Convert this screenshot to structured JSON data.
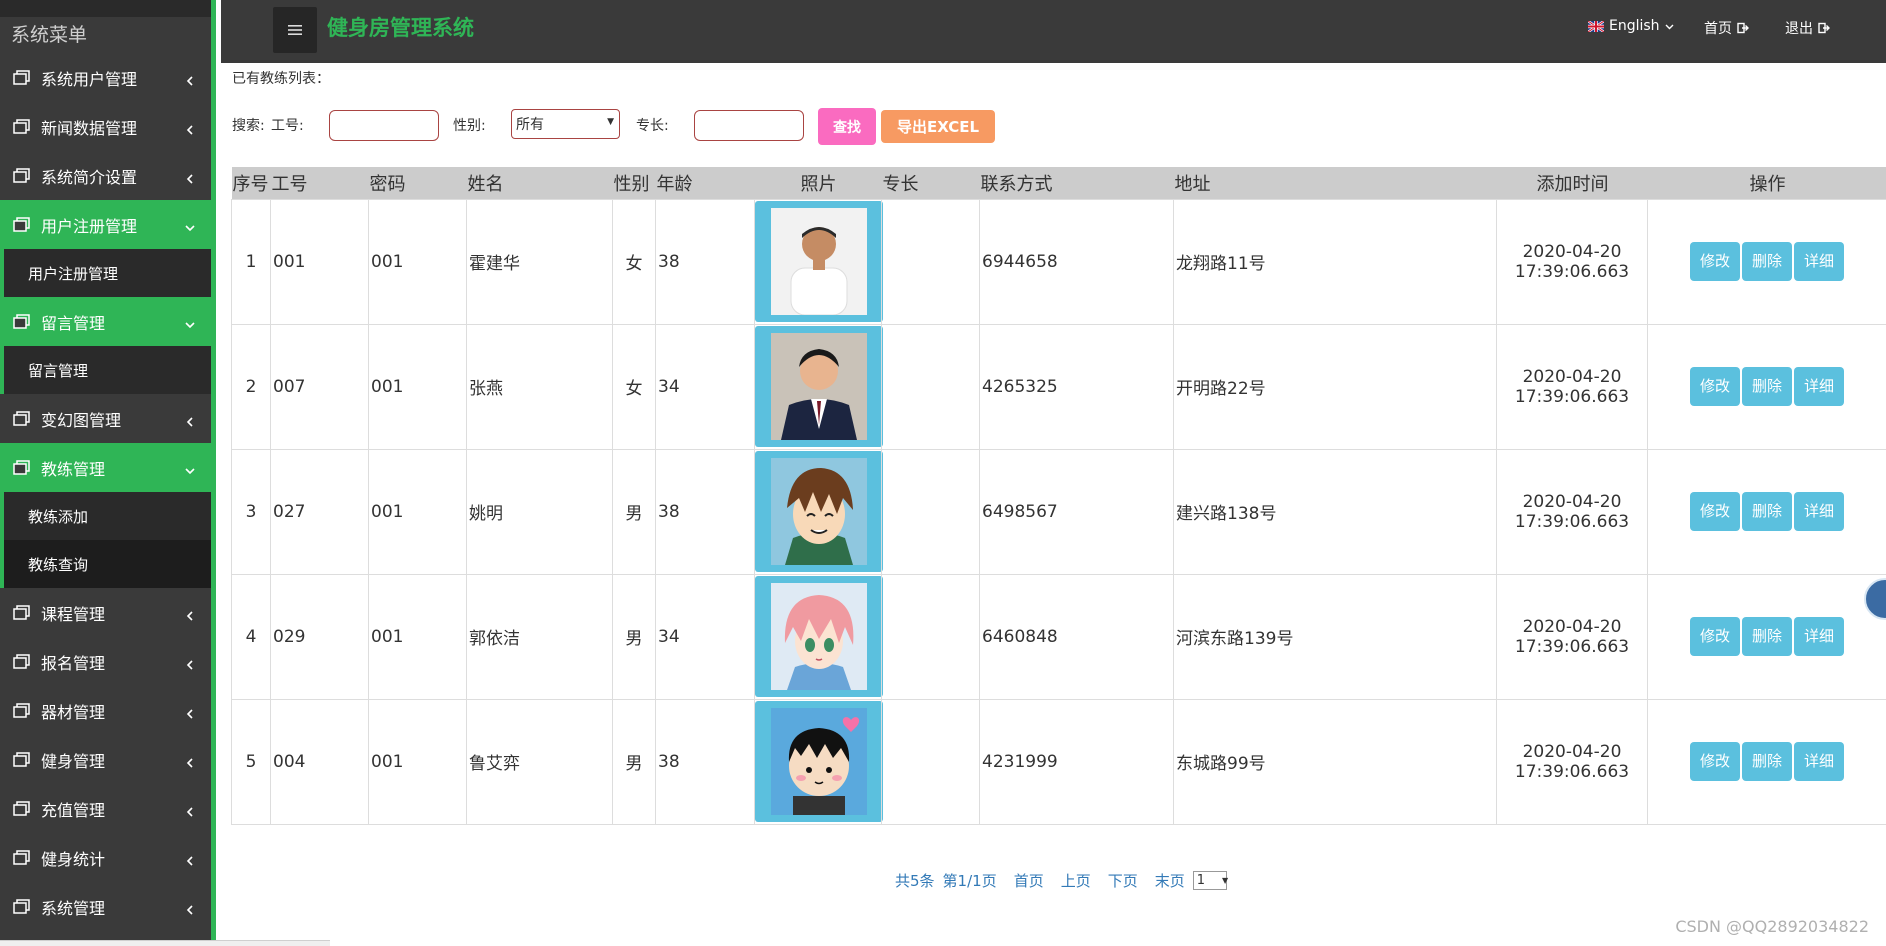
{
  "sidebar": {
    "title": "系统菜单",
    "items": [
      {
        "label": "系统用户管理",
        "active": false
      },
      {
        "label": "新闻数据管理",
        "active": false
      },
      {
        "label": "系统简介设置",
        "active": false
      },
      {
        "label": "用户注册管理",
        "active": true,
        "sub": [
          "用户注册管理"
        ]
      },
      {
        "label": "留言管理",
        "active": true,
        "sub": [
          "留言管理"
        ]
      },
      {
        "label": "变幻图管理",
        "active": false
      },
      {
        "label": "教练管理",
        "active": true,
        "sub": [
          "教练添加",
          "教练查询"
        ]
      },
      {
        "label": "课程管理",
        "active": false
      },
      {
        "label": "报名管理",
        "active": false
      },
      {
        "label": "器材管理",
        "active": false
      },
      {
        "label": "健身管理",
        "active": false
      },
      {
        "label": "充值管理",
        "active": false
      },
      {
        "label": "健身统计",
        "active": false
      },
      {
        "label": "系统管理",
        "active": false
      }
    ]
  },
  "header": {
    "app_title": "健身房管理系统",
    "language": "English",
    "home": "首页",
    "logout": "退出"
  },
  "main": {
    "caption": "已有教练列表：",
    "search": {
      "label": "搜索:",
      "id_label": "工号:",
      "id_value": "",
      "gender_label": "性别:",
      "gender_value": "所有",
      "specialty_label": "专长:",
      "specialty_value": "",
      "find_label": "查找",
      "export_label": "导出EXCEL"
    },
    "table": {
      "headers": [
        "序号",
        "工号",
        "密码",
        "姓名",
        "性别",
        "年龄",
        "照片",
        "专长",
        "联系方式",
        "地址",
        "添加时间",
        "操作"
      ],
      "rows": [
        {
          "no": "1",
          "id": "001",
          "pwd": "001",
          "name": "霍建华",
          "gender": "女",
          "age": "38",
          "photo": "man-white-shirt",
          "specialty": "",
          "phone": "6944658",
          "address": "龙翔路11号",
          "date": "2020-04-20",
          "time": "17:39:06.663"
        },
        {
          "no": "2",
          "id": "007",
          "pwd": "001",
          "name": "张燕",
          "gender": "女",
          "age": "34",
          "photo": "man-suit",
          "specialty": "",
          "phone": "4265325",
          "address": "开明路22号",
          "date": "2020-04-20",
          "time": "17:39:06.663"
        },
        {
          "no": "3",
          "id": "027",
          "pwd": "001",
          "name": "姚明",
          "gender": "男",
          "age": "38",
          "photo": "anime-brown-hair",
          "specialty": "",
          "phone": "6498567",
          "address": "建兴路138号",
          "date": "2020-04-20",
          "time": "17:39:06.663"
        },
        {
          "no": "4",
          "id": "029",
          "pwd": "001",
          "name": "郭依洁",
          "gender": "男",
          "age": "34",
          "photo": "anime-pink-hair",
          "specialty": "",
          "phone": "6460848",
          "address": "河滨东路139号",
          "date": "2020-04-20",
          "time": "17:39:06.663"
        },
        {
          "no": "5",
          "id": "004",
          "pwd": "001",
          "name": "鲁艾弈",
          "gender": "男",
          "age": "38",
          "photo": "cartoon-boy-heart",
          "specialty": "",
          "phone": "4231999",
          "address": "东城路99号",
          "date": "2020-04-20",
          "time": "17:39:06.663"
        }
      ],
      "actions": {
        "edit": "修改",
        "delete": "删除",
        "detail": "详细"
      }
    },
    "pager": {
      "total": "共5条",
      "page_info": "第1/1页",
      "first": "首页",
      "prev": "上页",
      "next": "下页",
      "last": "末页",
      "page_value": "1"
    }
  },
  "watermark": "CSDN @QQ2892034822",
  "colors": {
    "sidebar_bg": "#3a3a3a",
    "accent_green": "#2fb556",
    "header_bg": "#3a3a3a",
    "action_blue": "#5bc0de",
    "find_pink": "#fa6bc0",
    "export_orange": "#f79a62"
  }
}
